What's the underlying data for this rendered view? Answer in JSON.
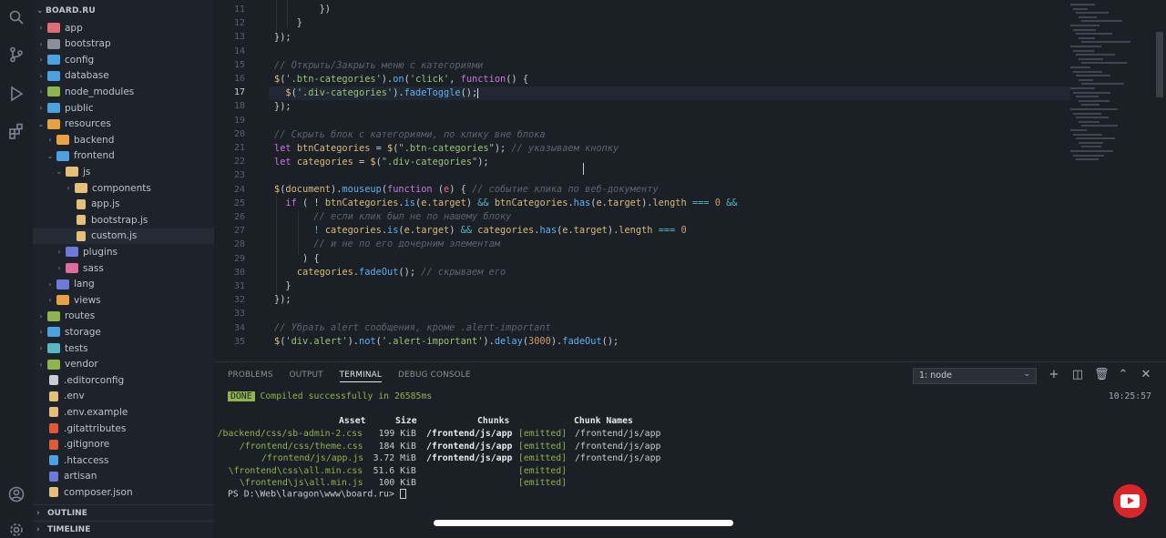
{
  "explorer": {
    "root": "BOARD.RU",
    "items": [
      {
        "label": "app",
        "depth": 1,
        "kind": "folder",
        "open": false,
        "color": "#e06c75"
      },
      {
        "label": "bootstrap",
        "depth": 1,
        "kind": "folder",
        "open": false,
        "color": "#8a909a"
      },
      {
        "label": "config",
        "depth": 1,
        "kind": "folder",
        "open": false,
        "color": "#4aa3df"
      },
      {
        "label": "database",
        "depth": 1,
        "kind": "folder",
        "open": false,
        "color": "#4aa3df"
      },
      {
        "label": "node_modules",
        "depth": 1,
        "kind": "folder",
        "open": false,
        "color": "#8fb34d"
      },
      {
        "label": "public",
        "depth": 1,
        "kind": "folder",
        "open": false,
        "color": "#4aa3df"
      },
      {
        "label": "resources",
        "depth": 1,
        "kind": "folder",
        "open": true,
        "color": "#e6a243"
      },
      {
        "label": "backend",
        "depth": 2,
        "kind": "folder",
        "open": false,
        "color": "#e6a243"
      },
      {
        "label": "frontend",
        "depth": 2,
        "kind": "folder",
        "open": true,
        "color": "#4aa3df"
      },
      {
        "label": "js",
        "depth": 3,
        "kind": "folder",
        "open": true,
        "color": "#e5c07b"
      },
      {
        "label": "components",
        "depth": 4,
        "kind": "folder",
        "open": false,
        "color": "#e5c07b"
      },
      {
        "label": "app.js",
        "depth": 4,
        "kind": "file",
        "color": "#e5c07b"
      },
      {
        "label": "bootstrap.js",
        "depth": 4,
        "kind": "file",
        "color": "#e5c07b"
      },
      {
        "label": "custom.js",
        "depth": 4,
        "kind": "file",
        "color": "#e5c07b",
        "selected": true
      },
      {
        "label": "plugins",
        "depth": 3,
        "kind": "folder",
        "open": false,
        "color": "#6c7bd8"
      },
      {
        "label": "sass",
        "depth": 3,
        "kind": "folder",
        "open": false,
        "color": "#e06c9c"
      },
      {
        "label": "lang",
        "depth": 2,
        "kind": "folder",
        "open": false,
        "color": "#6c7bd8"
      },
      {
        "label": "views",
        "depth": 2,
        "kind": "folder",
        "open": false,
        "color": "#e6a243"
      },
      {
        "label": "routes",
        "depth": 1,
        "kind": "folder",
        "open": false,
        "color": "#8fb34d"
      },
      {
        "label": "storage",
        "depth": 1,
        "kind": "folder",
        "open": false,
        "color": "#4aa3df"
      },
      {
        "label": "tests",
        "depth": 1,
        "kind": "folder",
        "open": false,
        "color": "#56b6c2"
      },
      {
        "label": "vendor",
        "depth": 1,
        "kind": "folder",
        "open": false,
        "color": "#8fb34d"
      },
      {
        "label": ".editorconfig",
        "depth": 1,
        "kind": "file",
        "color": "#c8ccd4"
      },
      {
        "label": ".env",
        "depth": 1,
        "kind": "file",
        "color": "#e5c07b"
      },
      {
        "label": ".env.example",
        "depth": 1,
        "kind": "file",
        "color": "#e5c07b"
      },
      {
        "label": ".gitattributes",
        "depth": 1,
        "kind": "file",
        "color": "#e05a3a"
      },
      {
        "label": ".gitignore",
        "depth": 1,
        "kind": "file",
        "color": "#e05a3a"
      },
      {
        "label": ".htaccess",
        "depth": 1,
        "kind": "file",
        "color": "#4aa3df"
      },
      {
        "label": "artisan",
        "depth": 1,
        "kind": "file",
        "color": "#6c7bd8"
      },
      {
        "label": "composer.json",
        "depth": 1,
        "kind": "file",
        "color": "#e5c07b"
      }
    ],
    "outline": "OUTLINE",
    "timeline": "TIMELINE"
  },
  "editor": {
    "line_numbers": [
      "11",
      "12",
      "13",
      "14",
      "15",
      "16",
      "17",
      "18",
      "19",
      "20",
      "21",
      "22",
      "23",
      "24",
      "25",
      "26",
      "27",
      "28",
      "29",
      "30",
      "31",
      "32",
      "33",
      "34",
      "35"
    ],
    "current_line": "17"
  },
  "panel": {
    "tabs": [
      "PROBLEMS",
      "OUTPUT",
      "TERMINAL",
      "DEBUG CONSOLE"
    ],
    "active_tab": "TERMINAL",
    "terminal_select": "1: node",
    "done_badge": "DONE",
    "compiled_msg": "Compiled successfully in 26585ms",
    "time": "10:25:57",
    "table_headers": {
      "asset": "Asset",
      "size": "Size",
      "chunks": "Chunks",
      "chunk_names": "Chunk Names"
    },
    "rows": [
      {
        "asset": "/backend/css/sb-admin-2.css",
        "size": "199 KiB",
        "chunk": "/frontend/js/app",
        "emitted": "[emitted]",
        "name": "/frontend/js/app"
      },
      {
        "asset": "/frontend/css/theme.css",
        "size": "184 KiB",
        "chunk": "/frontend/js/app",
        "emitted": "[emitted]",
        "name": "/frontend/js/app"
      },
      {
        "asset": "/frontend/js/app.js",
        "size": "3.72 MiB",
        "chunk": "/frontend/js/app",
        "emitted": "[emitted]",
        "name": "/frontend/js/app"
      },
      {
        "asset": "\\frontend\\css\\all.min.css",
        "size": "51.6 KiB",
        "chunk": "",
        "emitted": "[emitted]",
        "name": ""
      },
      {
        "asset": "\\frontend\\js\\all.min.js",
        "size": "100 KiB",
        "chunk": "",
        "emitted": "[emitted]",
        "name": ""
      }
    ],
    "prompt": "PS D:\\Web\\laragon\\www\\board.ru> "
  }
}
